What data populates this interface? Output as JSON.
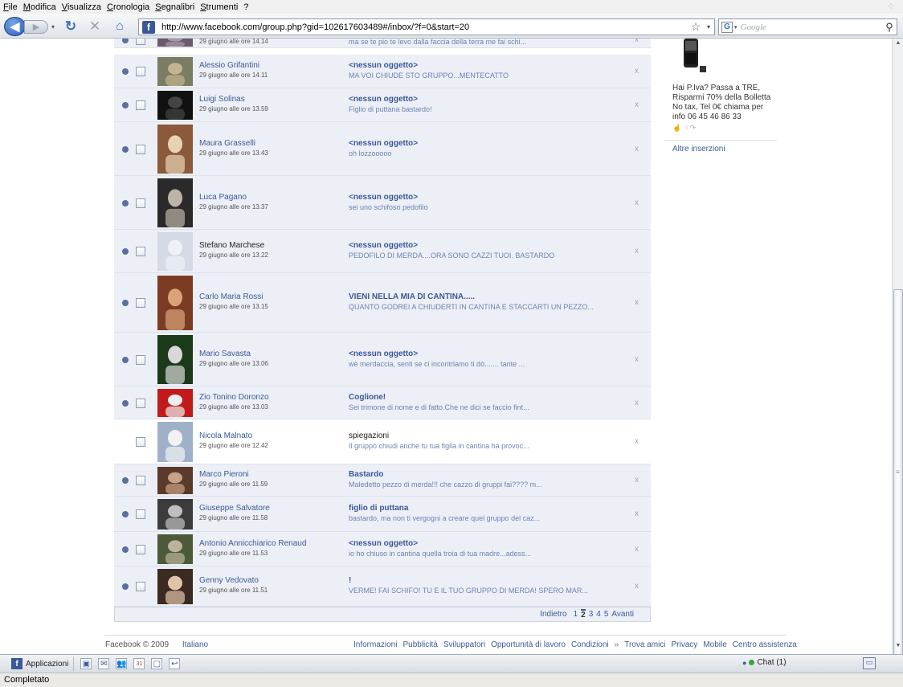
{
  "browser": {
    "menu": [
      "File",
      "Modifica",
      "Visualizza",
      "Cronologia",
      "Segnalibri",
      "Strumenti",
      "?"
    ],
    "url": "http://www.facebook.com/group.php?gid=102617603489#/inbox/?f=0&start=20",
    "favicon_letter": "f",
    "search_placeholder": "Google",
    "search_engine_letter": "G",
    "status": "Completato"
  },
  "icons": {
    "back": "◀",
    "forward": "▶",
    "history": "▾",
    "reload": "↻",
    "stop": "✕",
    "home": "⌂",
    "star": "☆",
    "dropdown": "▾",
    "search": "⚲",
    "delete": "x",
    "scroll_up": "▲",
    "scroll_down": "▼",
    "grip": "≡",
    "phone_brand": "Q",
    "likes": "☝ ☟ ↷"
  },
  "messages": [
    {
      "sender": "",
      "date": "29 giugno alle ore 14.14",
      "subject": "",
      "preview": "ma se te pio te levo dalla faccia della terra me fai schi...",
      "unread": true
    },
    {
      "sender": "Alessio Grifantini",
      "date": "29 giugno alle ore 14.11",
      "subject": "<nessun oggetto>",
      "preview": "MA VOI CHIUDE STO GRUPPO...MENTECATTO",
      "unread": true
    },
    {
      "sender": "Luigi Solinas",
      "date": "29 giugno alle ore 13.59",
      "subject": "<nessun oggetto>",
      "preview": "Figlio di puttana bastardo!",
      "unread": true
    },
    {
      "sender": "Maura Grasselli",
      "date": "29 giugno alle ore 13.43",
      "subject": "<nessun oggetto>",
      "preview": "oh lozzooooo",
      "unread": true
    },
    {
      "sender": "Luca Pagano",
      "date": "29 giugno alle ore 13.37",
      "subject": "<nessun oggetto>",
      "preview": "sei uno schifoso pedofilo",
      "unread": true
    },
    {
      "sender": "Stefano Marchese",
      "date": "29 giugno alle ore 13.22",
      "subject": "<nessun oggetto>",
      "preview": "PEDOFILO DI MERDA....ORA SONO CAZZI TUOI. BASTARDO",
      "unread": true
    },
    {
      "sender": "Carlo Maria Rossi",
      "date": "29 giugno alle ore 13.15",
      "subject": "VIENI NELLA MIA DI CANTINA.....",
      "preview": "QUANTO GODREI A CHIUDERTI IN CANTINA E STACCARTI UN PEZZO...",
      "unread": true
    },
    {
      "sender": "Mario Savasta",
      "date": "29 giugno alle ore 13.06",
      "subject": "<nessun oggetto>",
      "preview": "wè merdaccia, senti se ci incontriamo ti dò....... tante ...",
      "unread": true
    },
    {
      "sender": "Zio Tonino Doronzo",
      "date": "29 giugno alle ore 13.03",
      "subject": "Coglione!",
      "preview": "Sei trimone di nome e di fatto.Che ne dici se faccio fint...",
      "unread": true
    },
    {
      "sender": "Nicola Malnato",
      "date": "29 giugno alle ore 12.42",
      "subject": "spiegazioni",
      "preview": "Il gruppo chiudi anche tu tua figlia in cantina ha provoc...",
      "unread": false
    },
    {
      "sender": "Marco Pieroni",
      "date": "29 giugno alle ore 11.59",
      "subject": "Bastardo",
      "preview": "Maledetto pezzo di merda!!! che cazzo di gruppi fai???? m...",
      "unread": true
    },
    {
      "sender": "Giuseppe Salvatore",
      "date": "29 giugno alle ore 11.58",
      "subject": "figlio di puttana",
      "preview": "bastardo, ma non ti vergogni a creare quel gruppo del caz...",
      "unread": true
    },
    {
      "sender": "Antonio Annicchiarico Renaud",
      "date": "29 giugno alle ore 11.53",
      "subject": "<nessun oggetto>",
      "preview": "io ho chiuso in cantina quella troia di tua madre...adess...",
      "unread": true
    },
    {
      "sender": "Genny Vedovato",
      "date": "29 giugno alle ore 11.51",
      "subject": "!",
      "preview": "VERME! FAI SCHIFO! TU E IL TUO GRUPPO DI MERDA! SPERO MAR...",
      "unread": true
    }
  ],
  "pager": {
    "prev": "Indietro",
    "pages": [
      "1",
      "2",
      "3",
      "4",
      "5"
    ],
    "current": "2",
    "next": "Avanti"
  },
  "ad": {
    "text": "Hai P.Iva? Passa a TRE, Risparmi 70% della Bolletta No tax, Tel 0€ chiama per info 06 45 46 86 33",
    "more": "Altre inserzioni"
  },
  "footer": {
    "copyright": "Facebook © 2009",
    "language": "Italiano",
    "links": [
      "Informazioni",
      "Pubblicità",
      "Sviluppatori",
      "Opportunità di lavoro",
      "Condizioni",
      "»",
      "Trova amici",
      "Privacy",
      "Mobile",
      "Centro assistenza"
    ]
  },
  "chatbar": {
    "apps_label": "Applicazioni",
    "chat_label": "Chat",
    "chat_count": "(1)",
    "toolbar_glyphs": [
      "▣",
      "✉",
      "👥",
      "31",
      "▢",
      "↩"
    ]
  },
  "colors": {
    "fb_blue": "#3b5998",
    "unread_bg": "#eceff5",
    "preview_text": "#6d84b4"
  }
}
